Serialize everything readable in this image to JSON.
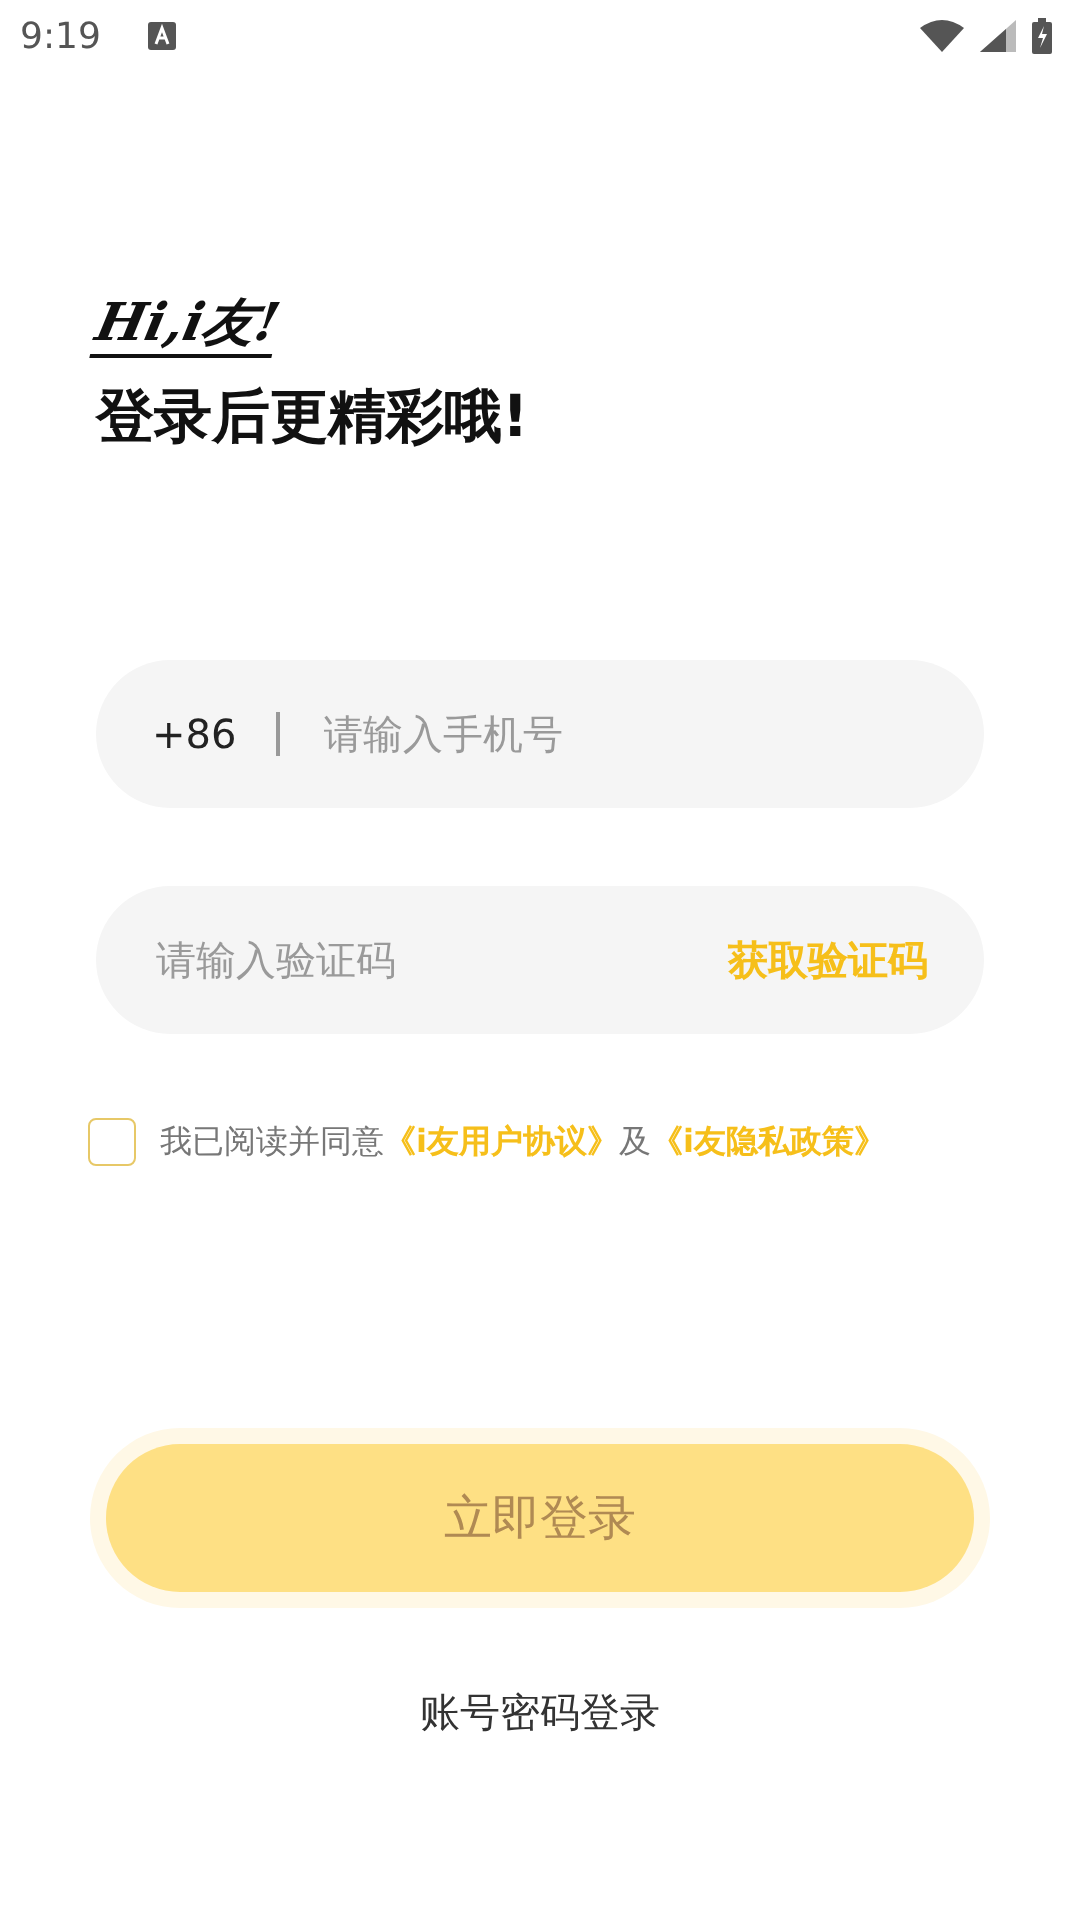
{
  "status_bar": {
    "time": "9:19"
  },
  "greeting": {
    "logo": "Hi,i友!",
    "headline": "登录后更精彩哦!"
  },
  "phone_field": {
    "prefix": "+86",
    "placeholder": "请输入手机号"
  },
  "code_field": {
    "placeholder": "请输入验证码",
    "action": "获取验证码"
  },
  "agreement": {
    "checked": false,
    "parts": [
      {
        "kind": "text",
        "text": "我已阅读并同意"
      },
      {
        "kind": "link",
        "text": "《i友用户协议》"
      },
      {
        "kind": "text",
        "text": "及"
      },
      {
        "kind": "link",
        "text": "《i友隐私政策》"
      }
    ]
  },
  "login_button": {
    "label": "立即登录",
    "disabled": true
  },
  "alt_login": "账号密码登录"
}
